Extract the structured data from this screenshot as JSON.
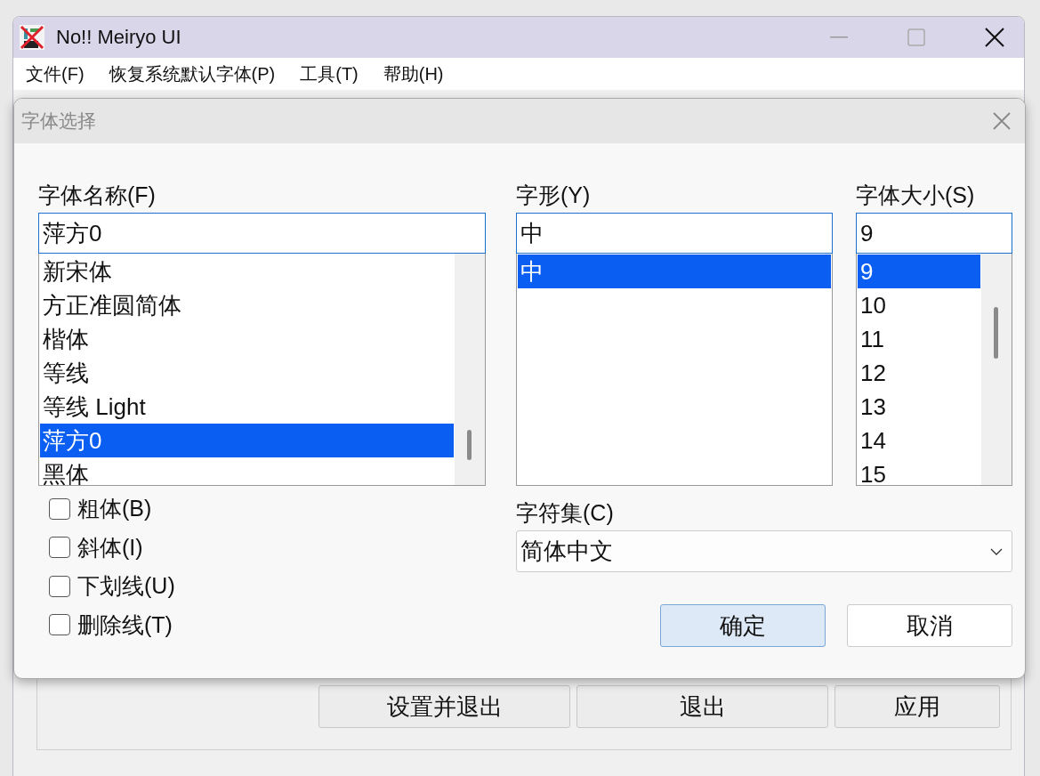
{
  "main_window": {
    "title": "No!! Meiryo UI",
    "menu": [
      "文件(F)",
      "恢复系统默认字体(P)",
      "工具(T)",
      "帮助(H)"
    ],
    "buttons": [
      "设置并退出",
      "退出",
      "应用"
    ]
  },
  "dialog": {
    "title": "字体选择",
    "font_name": {
      "label": "字体名称(F)",
      "value": "萍方0",
      "items": [
        {
          "label": "新宋体",
          "selected": false
        },
        {
          "label": "方正准圆简体",
          "selected": false
        },
        {
          "label": "楷体",
          "selected": false
        },
        {
          "label": "等线",
          "selected": false
        },
        {
          "label": "等线 Light",
          "selected": false
        },
        {
          "label": "萍方0",
          "selected": true
        },
        {
          "label": "黑体",
          "selected": false
        }
      ]
    },
    "font_style": {
      "label": "字形(Y)",
      "value": "中",
      "items": [
        {
          "label": "中",
          "selected": true
        }
      ]
    },
    "font_size": {
      "label": "字体大小(S)",
      "value": "9",
      "items": [
        {
          "label": "9",
          "selected": true
        },
        {
          "label": "10",
          "selected": false
        },
        {
          "label": "11",
          "selected": false
        },
        {
          "label": "12",
          "selected": false
        },
        {
          "label": "13",
          "selected": false
        },
        {
          "label": "14",
          "selected": false
        },
        {
          "label": "15",
          "selected": false
        }
      ]
    },
    "effects": [
      {
        "label": "粗体(B)",
        "checked": false
      },
      {
        "label": "斜体(I)",
        "checked": false
      },
      {
        "label": "下划线(U)",
        "checked": false
      },
      {
        "label": "删除线(T)",
        "checked": false
      }
    ],
    "charset": {
      "label": "字符集(C)",
      "value": "简体中文"
    },
    "buttons": [
      {
        "label": "确定",
        "default": true
      },
      {
        "label": "取消",
        "default": false
      }
    ]
  }
}
